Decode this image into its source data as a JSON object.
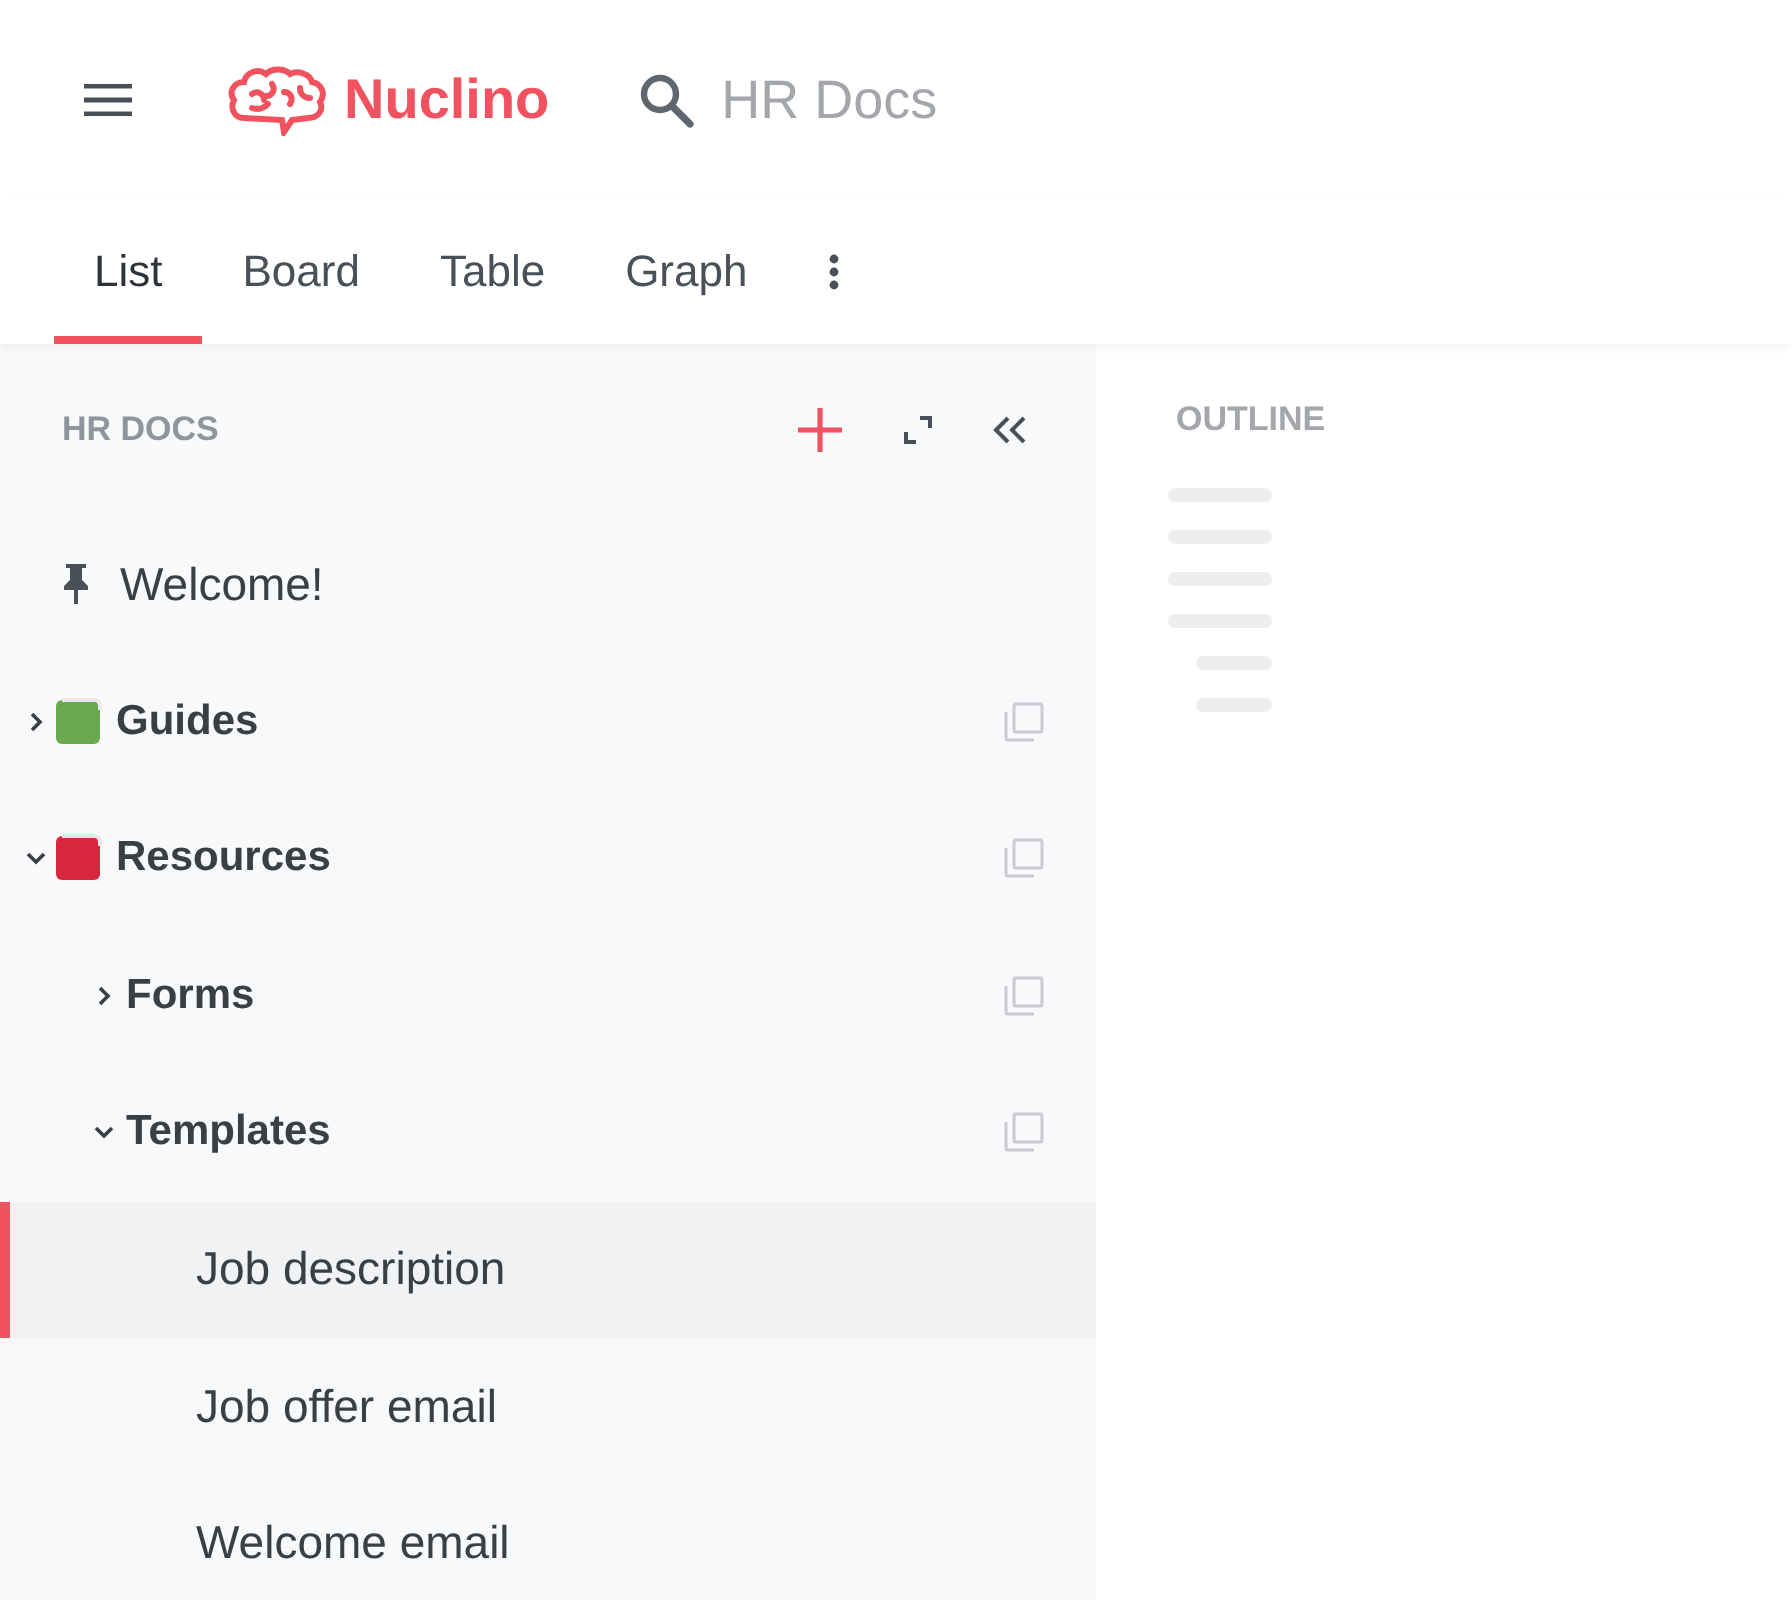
{
  "header": {
    "brand": "Nuclino",
    "search": {
      "placeholder": "HR Docs"
    }
  },
  "tabs": [
    {
      "label": "List",
      "selected": true
    },
    {
      "label": "Board",
      "selected": false
    },
    {
      "label": "Table",
      "selected": false
    },
    {
      "label": "Graph",
      "selected": false
    }
  ],
  "sidebar": {
    "title": "HR DOCS",
    "items": [
      {
        "kind": "pinned",
        "label": "Welcome!",
        "selected": false
      },
      {
        "kind": "folder",
        "label": "Guides",
        "color": "#6aa84f",
        "expanded": false,
        "selected": false
      },
      {
        "kind": "folder",
        "label": "Resources",
        "color": "#d9263f",
        "expanded": true,
        "selected": false,
        "children": [
          {
            "kind": "folder",
            "label": "Forms",
            "expanded": false,
            "selected": false
          },
          {
            "kind": "folder",
            "label": "Templates",
            "expanded": true,
            "selected": false,
            "children": [
              {
                "kind": "page",
                "label": "Job description",
                "selected": true
              },
              {
                "kind": "page",
                "label": "Job offer email",
                "selected": false
              },
              {
                "kind": "page",
                "label": "Welcome email",
                "selected": false
              }
            ]
          }
        ]
      }
    ]
  },
  "outline": {
    "title": "OUTLINE"
  }
}
